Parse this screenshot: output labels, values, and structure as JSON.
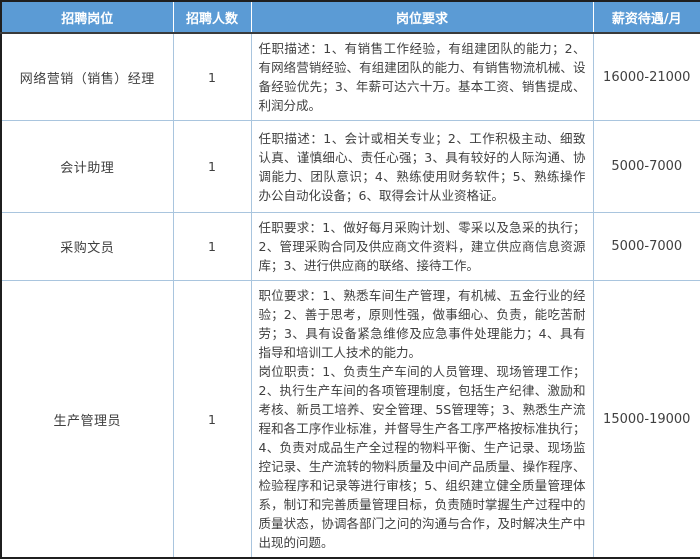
{
  "table": {
    "headers": [
      {
        "label": "招聘岗位"
      },
      {
        "label": "招聘人数"
      },
      {
        "label": "岗位要求"
      },
      {
        "label": "薪资待遇/月"
      }
    ],
    "rows": [
      {
        "position": "网络营销（销售）经理",
        "count": "1",
        "requirements": [
          "任职描述：1、有销售工作经验，有组建团队的能力；2、有网络营销经验、有组建团队的能力、有销售物流机械、设备经验优先；3、年薪可达六十万。基本工资、销售提成、利润分成。"
        ],
        "salary": "16000-21000"
      },
      {
        "position": "会计助理",
        "count": "1",
        "requirements": [
          "任职描述：1、会计或相关专业；2、工作积极主动、细致认真、谨慎细心、责任心强；3、具有较好的人际沟通、协调能力、团队意识；4、熟练使用财务软件；5、熟练操作办公自动化设备；6、取得会计从业资格证。"
        ],
        "salary": "5000-7000"
      },
      {
        "position": "采购文员",
        "count": "1",
        "requirements": [
          "任职要求：1、做好每月采购计划、零采以及急采的执行；2、管理采购合同及供应商文件资料，建立供应商信息资源库；3、进行供应商的联络、接待工作。"
        ],
        "salary": "5000-7000"
      },
      {
        "position": "生产管理员",
        "count": "1",
        "requirements": [
          "职位要求：1、熟悉车间生产管理，有机械、五金行业的经验；2、善于思考，原则性强，做事细心、负责，能吃苦耐劳；3、具有设备紧急维修及应急事件处理能力；4、具有指导和培训工人技术的能力。",
          "岗位职责：1、负责生产车间的人员管理、现场管理工作；2、执行生产车间的各项管理制度，包括生产纪律、激励和考核、新员工培养、安全管理、5S管理等；3、熟悉生产流程和各工序作业标准，并督导生产各工序严格按标准执行；4、负责对成品生产全过程的物料平衡、生产记录、现场监控记录、生产流转的物料质量及中间产品质量、操作程序、检验程序和记录等进行审核；5、组织建立健全质量管理体系，制订和完善质量管理目标，负责随时掌握生产过程中的质量状态，协调各部门之问的沟通与合作，及时解决生产中出现的问题。"
        ],
        "salary": "15000-19000"
      }
    ]
  },
  "colors": {
    "header_bg": "#5b9bd5",
    "header_text": "#ffffff",
    "cell_text": "#3f3f3f",
    "inner_border": "#a9c5de",
    "outer_border": "#1f1f1f"
  }
}
